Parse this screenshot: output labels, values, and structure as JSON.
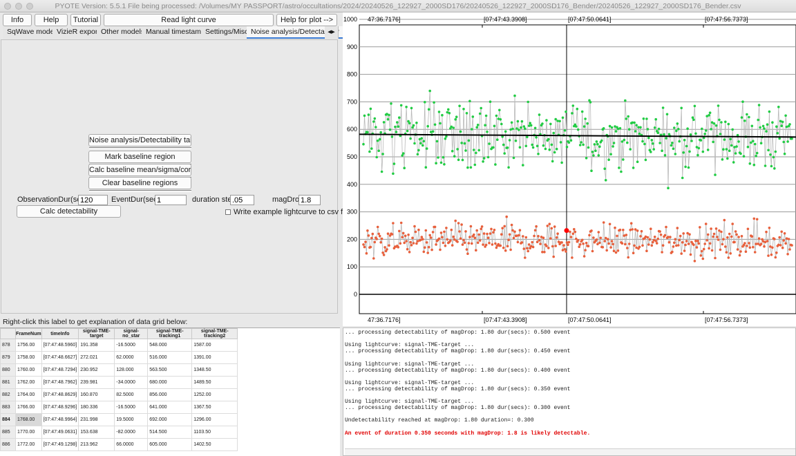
{
  "title": "PYOTE Version: 5.5.1  File being processed: /Volumes/MY PASSPORT/astro/occultations/2024/20240526_122927_2000SD176/20240526_122927_2000SD176_Bender/20240526_122927_2000SD176_Bender.csv",
  "toolbar": {
    "info": "Info",
    "help": "Help",
    "tutorial": "Tutorial",
    "read_light_curve": "Read light curve",
    "help_for_plot": "Help for plot -->"
  },
  "tabs": [
    "SqWave model",
    "VizieR export",
    "Other models",
    "Manual timestamps",
    "Settings/Misc.",
    "Noise analysis/Detectability"
  ],
  "noise": {
    "help_btn": "Noise analysis/Detectability tab help",
    "mark_btn": "Mark baseline region",
    "calc_btn": "Calc baseline mean/sigma/corr coeffs",
    "clear_btn": "Clear baseline regions",
    "obs_label": "ObservationDur(secs):",
    "obs_value": "120",
    "event_label": "EventDur(secs):",
    "event_value": "1",
    "step_label": "duration step:",
    "step_value": ".05",
    "mag_label": "magDrop:",
    "mag_value": "1.8",
    "calc_detect_btn": "Calc detectability",
    "write_csv_label": "Write example lightcurve to csv file"
  },
  "grid_label": "Right-click this label to get explanation of data grid below:",
  "grid": {
    "columns": [
      "FrameNum",
      "timeInfo",
      "signal-TME-target",
      "signal-no_star",
      "signal-TME-tracking1",
      "signal-TME-tracking2"
    ],
    "rows": [
      [
        "878",
        "1756.00",
        "[07:47:48.5960]",
        "191.358",
        "-16.5000",
        "548.000",
        "1587.00"
      ],
      [
        "879",
        "1758.00",
        "[07:47:48.6627]",
        "272.021",
        "62.0000",
        "516.000",
        "1391.00"
      ],
      [
        "880",
        "1760.00",
        "[07:47:48.7294]",
        "230.952",
        "128.000",
        "563.500",
        "1348.50"
      ],
      [
        "881",
        "1762.00",
        "[07:47:48.7962]",
        "239.981",
        "-34.0000",
        "680.000",
        "1489.50"
      ],
      [
        "882",
        "1764.00",
        "[07:47:48.8629]",
        "160.870",
        "82.5000",
        "856.000",
        "1252.00"
      ],
      [
        "883",
        "1766.00",
        "[07:47:48.9296]",
        "180.336",
        "-16.5000",
        "641.000",
        "1367.50"
      ],
      [
        "884",
        "1768.00",
        "[07:47:48.9964]",
        "231.998",
        "19.5000",
        "692.000",
        "1296.00"
      ],
      [
        "885",
        "1770.00",
        "[07:47:49.0631]",
        "153.638",
        "-82.0000",
        "514.500",
        "1103.50"
      ],
      [
        "886",
        "1772.00",
        "[07:47:49.1298]",
        "213.962",
        "66.0000",
        "605.000",
        "1402.50"
      ]
    ],
    "selected_row": "884"
  },
  "chart_data": {
    "type": "scatter",
    "top_ticks": [
      "47:36.7176]",
      "[07:47:43.3908]",
      "[07:47:50.0641]",
      "[07:47:56.7373]"
    ],
    "bottom_ticks": [
      "47:36.7176]",
      "[07:47:43.3908]",
      "[07:47:50.0641]",
      "[07:47:56.7373]"
    ],
    "yticks": [
      "1000",
      "900",
      "800",
      "700",
      "600",
      "500",
      "400",
      "300",
      "200",
      "100",
      "0"
    ],
    "ylim": [
      0,
      1000
    ],
    "grid": true,
    "cursor_time": "[07:47:50.0641]",
    "highlight_point": 231.998,
    "series": [
      {
        "color": "#22cc44",
        "mean": 572,
        "spread": 110
      },
      {
        "color": "#e8603c",
        "mean": 195,
        "spread": 55
      }
    ],
    "trend_line": {
      "start": 582,
      "end": 572,
      "color": "#000000"
    }
  },
  "log_lines": [
    "... processing detectability of magDrop: 1.80 dur(secs): 0.500 event",
    "",
    "Using lightcurve: signal-TME-target ...",
    "... processing detectability of magDrop: 1.80 dur(secs): 0.450 event",
    "",
    "Using lightcurve: signal-TME-target ...",
    "... processing detectability of magDrop: 1.80 dur(secs): 0.400 event",
    "",
    "Using lightcurve: signal-TME-target ...",
    "... processing detectability of magDrop: 1.80 dur(secs): 0.350 event",
    "",
    "Using lightcurve: signal-TME-target ...",
    "... processing detectability of magDrop: 1.80 dur(secs): 0.300 event",
    "",
    "Undetectability reached at magDrop: 1.80 duration=: 0.300",
    ""
  ],
  "log_final": "An event of duration 0.350 seconds with magDrop: 1.8 is likely detectable.",
  "colors": {
    "green_points": "#22cc44",
    "red_points": "#e8603c",
    "highlight": "#ff0000",
    "log_red": "#e00000"
  }
}
